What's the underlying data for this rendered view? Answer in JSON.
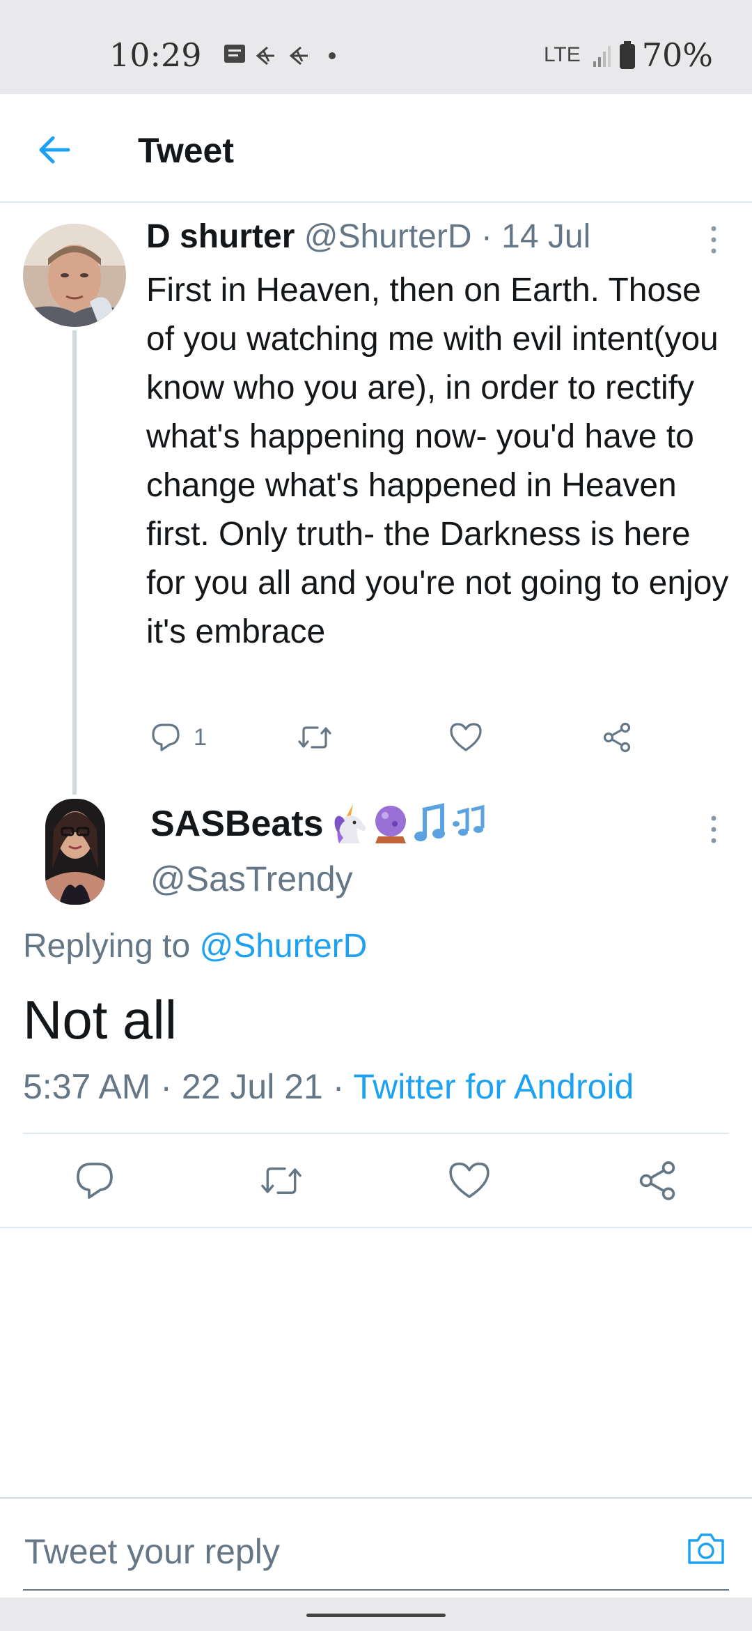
{
  "status_bar": {
    "time": "10:29",
    "network": "LTE",
    "battery": "70%"
  },
  "appbar": {
    "title": "Tweet"
  },
  "parent_tweet": {
    "name": "D shurter",
    "handle": "@ShurterD",
    "separator": " · ",
    "date": "14 Jul",
    "text": "First in Heaven, then on Earth. Those of you watching me with evil intent(you know who you are), in order to rectify what's happening now- you'd have to change what's happened in Heaven first. Only truth- the Darkness is here for you all and you're not going to enjoy it's embrace",
    "reply_count": "1"
  },
  "main_tweet": {
    "name": "SASBeats",
    "handle": "@SasTrendy",
    "replying_prefix": "Replying to ",
    "replying_to": "@ShurterD",
    "text": "Not all",
    "time": "5:37 AM",
    "separator": " · ",
    "date": "22 Jul 21",
    "separator2": " · ",
    "source": "Twitter for Android"
  },
  "composer": {
    "placeholder": "Tweet your reply"
  },
  "colors": {
    "accent": "#1da1f2",
    "secondary_text": "#657786",
    "divider": "#e1e8ed"
  },
  "icons": [
    "back-arrow-icon",
    "more-vertical-icon",
    "reply-icon",
    "retweet-icon",
    "like-icon",
    "share-icon",
    "camera-icon",
    "unicorn-emoji",
    "crystal-ball-emoji",
    "music-notes-emoji"
  ]
}
